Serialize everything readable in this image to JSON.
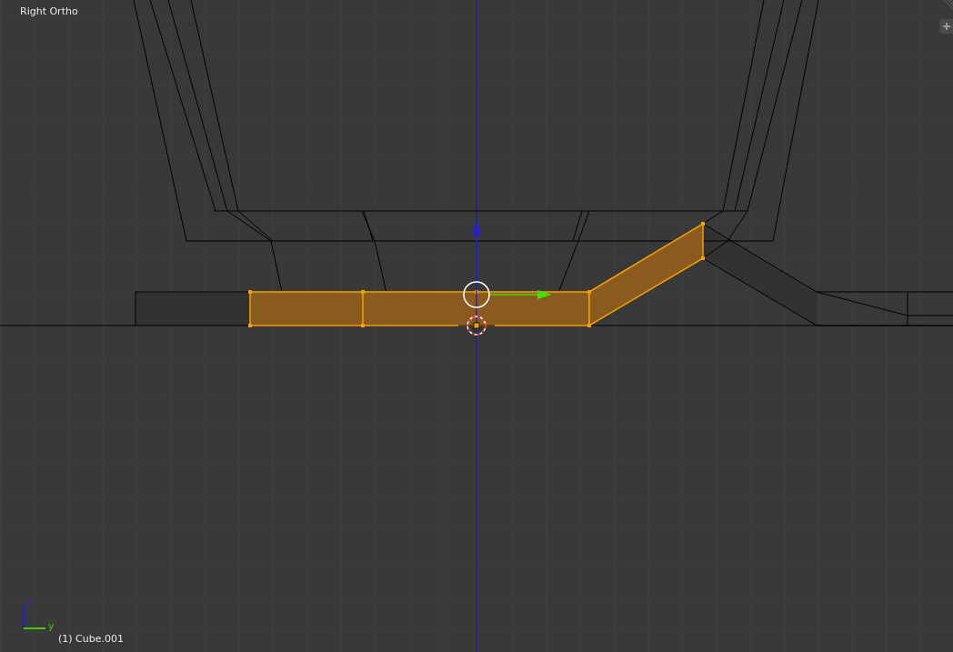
{
  "viewport": {
    "view_label": "Right Ortho",
    "object_label": "(1) Cube.001"
  },
  "axis_gizmo": {
    "vertical_label": "z",
    "horizontal_label": "y"
  }
}
